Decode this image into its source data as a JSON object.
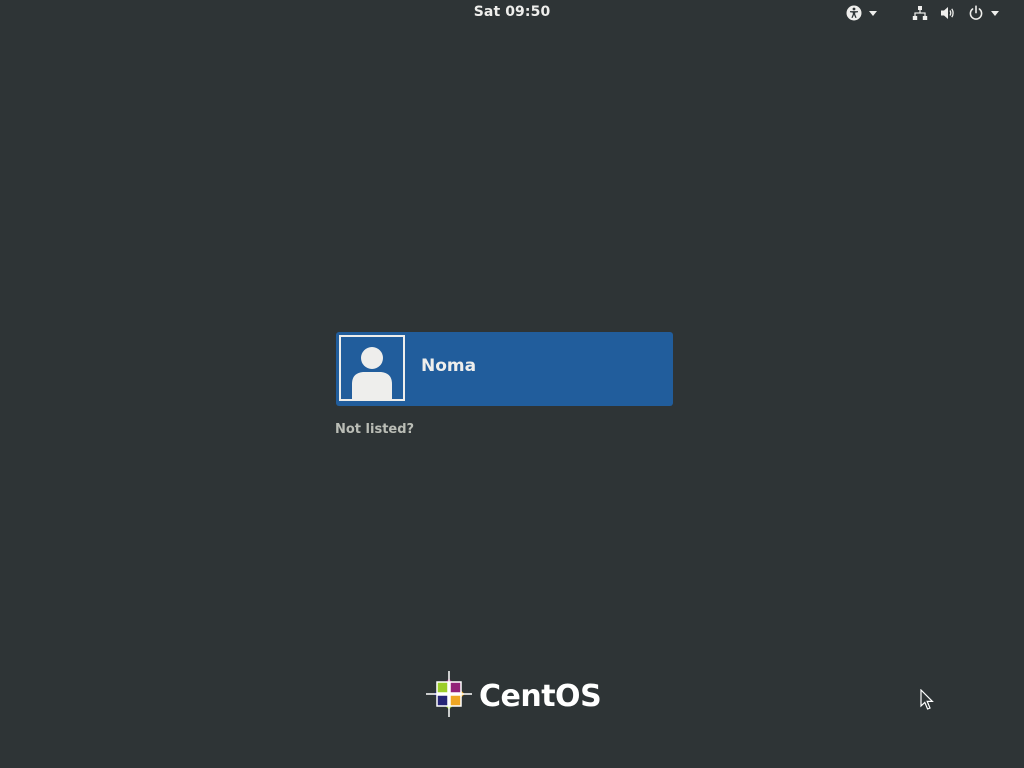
{
  "topbar": {
    "clock": "Sat 09:50",
    "icons": {
      "accessibility": "accessibility-icon",
      "network": "network-wired-icon",
      "volume": "volume-icon",
      "power": "power-icon",
      "dropdown": "chevron-down-icon"
    }
  },
  "login": {
    "users": [
      {
        "name": "Noma",
        "avatar": "default-user-avatar-icon"
      }
    ],
    "not_listed": "Not listed?"
  },
  "branding": {
    "logo_text": "CentOS"
  },
  "colors": {
    "background": "#2e3436",
    "selected_user": "#215d9c",
    "text": "#eeeeec",
    "muted_text": "#babdb6"
  }
}
